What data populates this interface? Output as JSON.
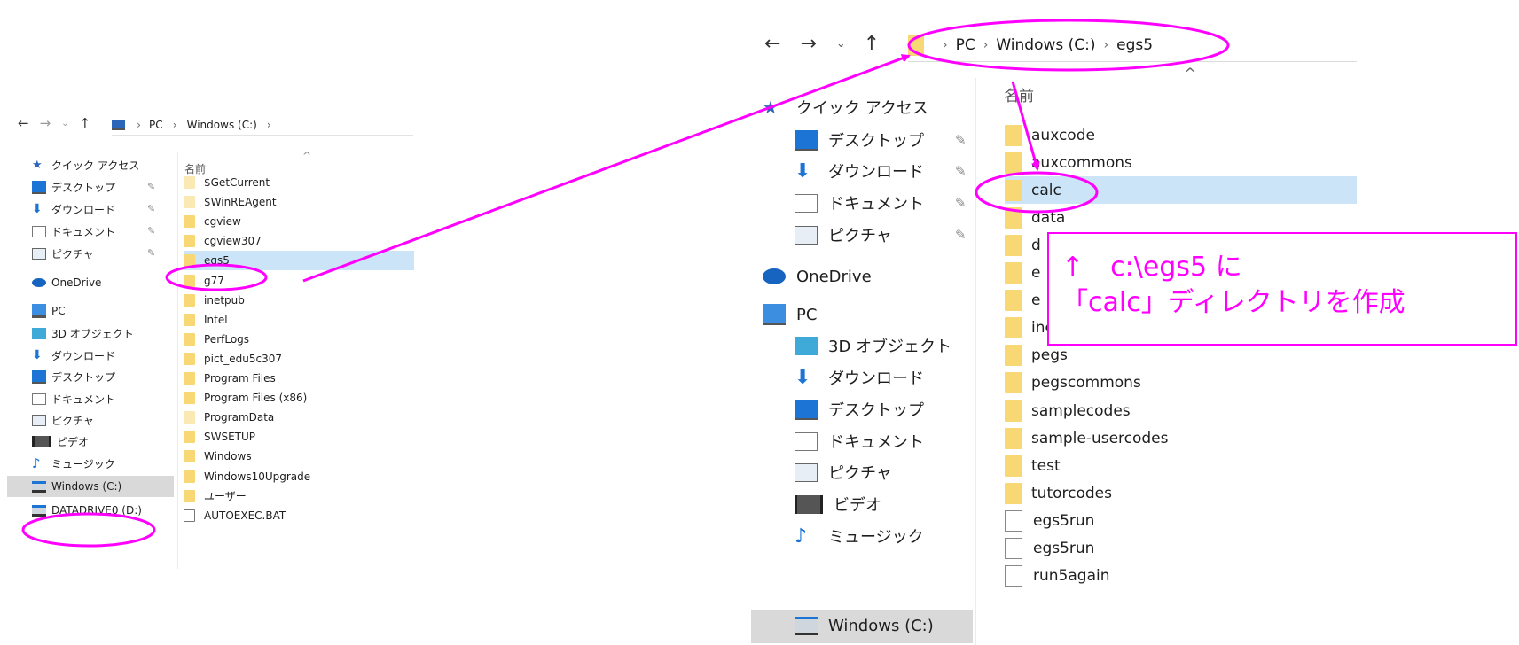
{
  "left": {
    "breadcrumb": [
      "PC",
      "Windows (C:)"
    ],
    "column_header": "名前",
    "sort_glyph": "^",
    "sidebar": [
      {
        "label": "クイック アクセス",
        "icon": "star-icon"
      },
      {
        "label": "デスクトップ",
        "icon": "desktop-icon",
        "pinned": true
      },
      {
        "label": "ダウンロード",
        "icon": "download-icon",
        "pinned": true
      },
      {
        "label": "ドキュメント",
        "icon": "document-icon",
        "pinned": true
      },
      {
        "label": "ピクチャ",
        "icon": "picture-icon",
        "pinned": true
      },
      {
        "label": "OneDrive",
        "icon": "cloud-icon"
      },
      {
        "label": "PC",
        "icon": "pc-icon"
      },
      {
        "label": "3D オブジェクト",
        "icon": "cube-icon"
      },
      {
        "label": "ダウンロード",
        "icon": "download-icon"
      },
      {
        "label": "デスクトップ",
        "icon": "desktop-icon"
      },
      {
        "label": "ドキュメント",
        "icon": "document-icon"
      },
      {
        "label": "ピクチャ",
        "icon": "picture-icon"
      },
      {
        "label": "ビデオ",
        "icon": "video-icon"
      },
      {
        "label": "ミュージック",
        "icon": "music-icon"
      },
      {
        "label": "Windows (C:)",
        "icon": "drive-icon",
        "selected": true
      },
      {
        "label": "DATADRIVE0 (D:)",
        "icon": "drive-icon"
      }
    ],
    "files": [
      {
        "name": "$GetCurrent",
        "type": "folder-faded"
      },
      {
        "name": "$WinREAgent",
        "type": "folder-faded"
      },
      {
        "name": "cgview",
        "type": "folder"
      },
      {
        "name": "cgview307",
        "type": "folder"
      },
      {
        "name": "egs5",
        "type": "folder",
        "selected": true
      },
      {
        "name": "g77",
        "type": "folder"
      },
      {
        "name": "inetpub",
        "type": "folder"
      },
      {
        "name": "Intel",
        "type": "folder"
      },
      {
        "name": "PerfLogs",
        "type": "folder"
      },
      {
        "name": "pict_edu5c307",
        "type": "folder"
      },
      {
        "name": "Program Files",
        "type": "folder"
      },
      {
        "name": "Program Files (x86)",
        "type": "folder"
      },
      {
        "name": "ProgramData",
        "type": "folder-faded"
      },
      {
        "name": "SWSETUP",
        "type": "folder"
      },
      {
        "name": "Windows",
        "type": "folder"
      },
      {
        "name": "Windows10Upgrade",
        "type": "folder"
      },
      {
        "name": "ユーザー",
        "type": "folder"
      },
      {
        "name": "AUTOEXEC.BAT",
        "type": "batch"
      }
    ]
  },
  "right": {
    "breadcrumb": [
      "PC",
      "Windows (C:)",
      "egs5"
    ],
    "column_header": "名前",
    "sort_glyph": "^",
    "sidebar": [
      {
        "label": "クイック アクセス",
        "icon": "star-icon"
      },
      {
        "label": "デスクトップ",
        "icon": "desktop-icon",
        "pinned": true
      },
      {
        "label": "ダウンロード",
        "icon": "download-icon",
        "pinned": true
      },
      {
        "label": "ドキュメント",
        "icon": "document-icon",
        "pinned": true
      },
      {
        "label": "ピクチャ",
        "icon": "picture-icon",
        "pinned": true
      },
      {
        "label": "OneDrive",
        "icon": "cloud-icon"
      },
      {
        "label": "PC",
        "icon": "pc-icon"
      },
      {
        "label": "3D オブジェクト",
        "icon": "cube-icon"
      },
      {
        "label": "ダウンロード",
        "icon": "download-icon"
      },
      {
        "label": "デスクトップ",
        "icon": "desktop-icon"
      },
      {
        "label": "ドキュメント",
        "icon": "document-icon"
      },
      {
        "label": "ピクチャ",
        "icon": "picture-icon"
      },
      {
        "label": "ビデオ",
        "icon": "video-icon"
      },
      {
        "label": "ミュージック",
        "icon": "music-icon"
      },
      {
        "label": "Windows (C:)",
        "icon": "drive-icon",
        "selected": true
      }
    ],
    "files": [
      {
        "name": "auxcode",
        "type": "folder"
      },
      {
        "name": "auxcommons",
        "type": "folder"
      },
      {
        "name": "calc",
        "type": "folder",
        "selected": true
      },
      {
        "name": "data",
        "type": "folder"
      },
      {
        "name": "d",
        "type": "folder"
      },
      {
        "name": "e",
        "type": "folder"
      },
      {
        "name": "e",
        "type": "folder"
      },
      {
        "name": "include",
        "type": "folder"
      },
      {
        "name": "pegs",
        "type": "folder"
      },
      {
        "name": "pegscommons",
        "type": "folder"
      },
      {
        "name": "samplecodes",
        "type": "folder"
      },
      {
        "name": "sample-usercodes",
        "type": "folder"
      },
      {
        "name": "test",
        "type": "folder"
      },
      {
        "name": "tutorcodes",
        "type": "folder"
      },
      {
        "name": "egs5run",
        "type": "file"
      },
      {
        "name": "egs5run",
        "type": "batch"
      },
      {
        "name": "run5again",
        "type": "file"
      }
    ]
  },
  "annotation": {
    "line1": "↑　c:\\egs5 に",
    "line2": "「calc」ディレクトリを作成"
  },
  "colors": {
    "accent": "#ff00ff",
    "selection": "#cce4f7",
    "folder": "#f8d775"
  }
}
